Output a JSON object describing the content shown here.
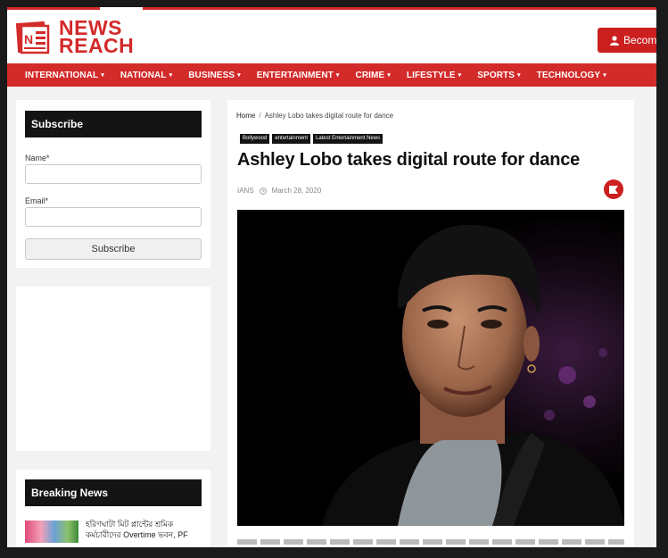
{
  "header": {
    "logo_line1": "NEWS",
    "logo_line2": "REACH",
    "become_label": "Becom",
    "user_icon": "user-icon"
  },
  "nav": {
    "items": [
      {
        "label": "INTERNATIONAL"
      },
      {
        "label": "NATIONAL"
      },
      {
        "label": "BUSINESS"
      },
      {
        "label": "ENTERTAINMENT"
      },
      {
        "label": "CRIME"
      },
      {
        "label": "LIFESTYLE"
      },
      {
        "label": "SPORTS"
      },
      {
        "label": "TECHNOLOGY"
      }
    ],
    "caret": "▾"
  },
  "sidebar": {
    "subscribe": {
      "title": "Subscribe",
      "name_label": "Name*",
      "name_value": "",
      "email_label": "Email*",
      "email_value": "",
      "button_label": "Subscribe"
    },
    "breaking": {
      "title": "Breaking News",
      "item_text": "হরিণঘাটা মিট প্লান্টের শ্রমিক কর্মচারীদের Overtime ভবন, PF"
    }
  },
  "article": {
    "breadcrumb_home": "Home",
    "breadcrumb_sep": "/",
    "breadcrumb_current": "Ashley Lobo takes digital route for dance",
    "tags": [
      "Bollywood",
      "entertainment",
      "Latest Entertainment News"
    ],
    "title": "Ashley Lobo takes digital route for dance",
    "author": "IANS",
    "date": "March 28, 2020"
  },
  "colors": {
    "brand_red": "#d32a2a",
    "widget_title_bg": "#141414"
  }
}
